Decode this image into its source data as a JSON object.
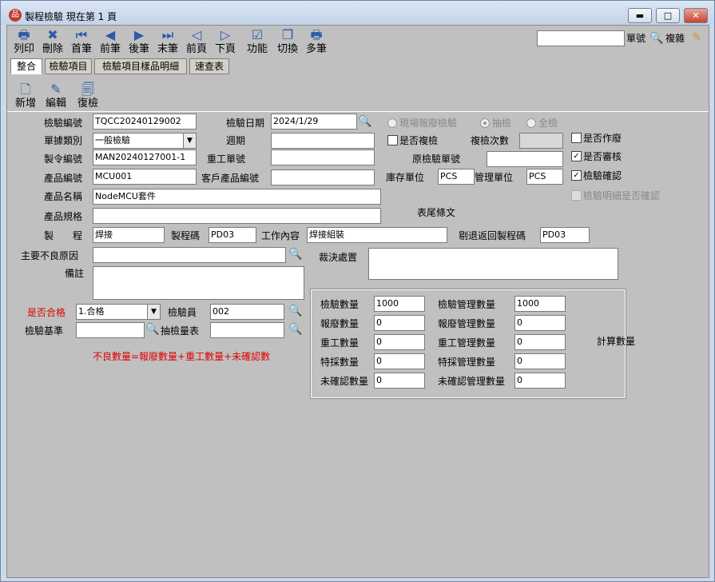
{
  "window": {
    "title": "製程檢驗  現在第 1 頁",
    "min": "▬",
    "max": "□",
    "close": "✕"
  },
  "toolbar": [
    {
      "label": "列印",
      "icon": "printer-icon",
      "glyph": "🖶"
    },
    {
      "label": "刪除",
      "icon": "delete-icon",
      "glyph": "✖"
    },
    {
      "label": "首筆",
      "icon": "first-record-icon",
      "glyph": "⏮"
    },
    {
      "label": "前筆",
      "icon": "prev-record-icon",
      "glyph": "◀"
    },
    {
      "label": "後筆",
      "icon": "next-record-icon",
      "glyph": "▶"
    },
    {
      "label": "末筆",
      "icon": "last-record-icon",
      "glyph": "⏭"
    },
    {
      "label": "前頁",
      "icon": "prev-page-icon",
      "glyph": "◁"
    },
    {
      "label": "下頁",
      "icon": "next-page-icon",
      "glyph": "▷"
    },
    {
      "label": "功能",
      "icon": "function-icon",
      "glyph": "☑"
    },
    {
      "label": "切換",
      "icon": "switch-icon",
      "glyph": "❐"
    },
    {
      "label": "多筆",
      "icon": "multi-record-icon",
      "glyph": "🖶"
    }
  ],
  "top_right": {
    "doc_no_label": "單號",
    "copy_label": "複雜"
  },
  "tabs": [
    "整合",
    "檢驗項目",
    "檢驗項目樣品明細",
    "速查表"
  ],
  "toolbar2": [
    {
      "label": "新增",
      "icon": "new-doc-icon",
      "glyph": "🗋"
    },
    {
      "label": "編輯",
      "icon": "edit-icon",
      "glyph": "✎"
    },
    {
      "label": "復檢",
      "icon": "recheck-icon",
      "glyph": "🗐"
    }
  ],
  "form": {
    "inspection_no_label": "檢驗編號",
    "inspection_no": "TQCC20240129002",
    "inspection_date_label": "檢驗日期",
    "inspection_date": "2024/1/29",
    "radio_onsite": "現場報廢檢驗",
    "radio_sample": "抽檢",
    "radio_full": "全檢",
    "doc_type_label": "單據類別",
    "doc_type": "一般檢驗",
    "period_label": "週期",
    "period": "",
    "is_recheck_label": "是否複檢",
    "recheck_count_label": "複檢次數",
    "recheck_count": "",
    "is_void_label": "是否作廢",
    "mo_no_label": "製令編號",
    "mo_no": "MAN20240127001-1",
    "rework_no_label": "重工單號",
    "rework_no": "",
    "orig_inspection_label": "原檢驗單號",
    "orig_inspection": "",
    "is_reviewed_label": "是否審核",
    "product_no_label": "產品編號",
    "product_no": "MCU001",
    "cust_product_label": "客戶產品編號",
    "cust_product": "",
    "stock_unit_label": "庫存單位",
    "stock_unit": "PCS",
    "mgmt_unit_label": "管理單位",
    "mgmt_unit": "PCS",
    "inspect_confirm_label": "檢驗確認",
    "product_name_label": "產品名稱",
    "product_name": "NodeMCU套件",
    "detail_confirm_label": "檢驗明細是否確認",
    "product_spec_label": "產品規格",
    "product_spec": "",
    "footer_label": "表尾條文",
    "process_label": "製　　程",
    "process": "焊接",
    "process_code_label": "製程碼",
    "process_code": "PD03",
    "work_content_label": "工作內容",
    "work_content": "焊接組裝",
    "return_code_label": "剔退返回製程碼",
    "return_code": "PD03",
    "main_defect_label": "主要不良原因",
    "main_defect": "",
    "disposition_label": "裁決處置",
    "disposition": "",
    "remark_label": "備註",
    "remark": "",
    "is_pass_label": "是否合格",
    "is_pass": "1.合格",
    "inspector_label": "檢驗員",
    "inspector": "002",
    "standard_label": "檢驗基準",
    "standard": "",
    "sample_table_label": "抽檢量表",
    "sample_table": "",
    "formula": "不良數量=報廢數量+重工數量+未確認數"
  },
  "quantities": {
    "inspect_qty_label": "檢驗數量",
    "inspect_qty": "1000",
    "inspect_mgmt_label": "檢驗管理數量",
    "inspect_mgmt": "1000",
    "scrap_qty_label": "報廢數量",
    "scrap_qty": "0",
    "scrap_mgmt_label": "報廢管理數量",
    "scrap_mgmt": "0",
    "rework_qty_label": "重工數量",
    "rework_qty": "0",
    "rework_mgmt_label": "重工管理數量",
    "rework_mgmt": "0",
    "special_qty_label": "特採數量",
    "special_qty": "0",
    "special_mgmt_label": "特採管理數量",
    "special_mgmt": "0",
    "unconfirmed_qty_label": "未確認數量",
    "unconfirmed_qty": "0",
    "unconfirmed_mgmt_label": "未確認管理數量",
    "unconfirmed_mgmt": "0",
    "calc_label": "計算數量"
  }
}
